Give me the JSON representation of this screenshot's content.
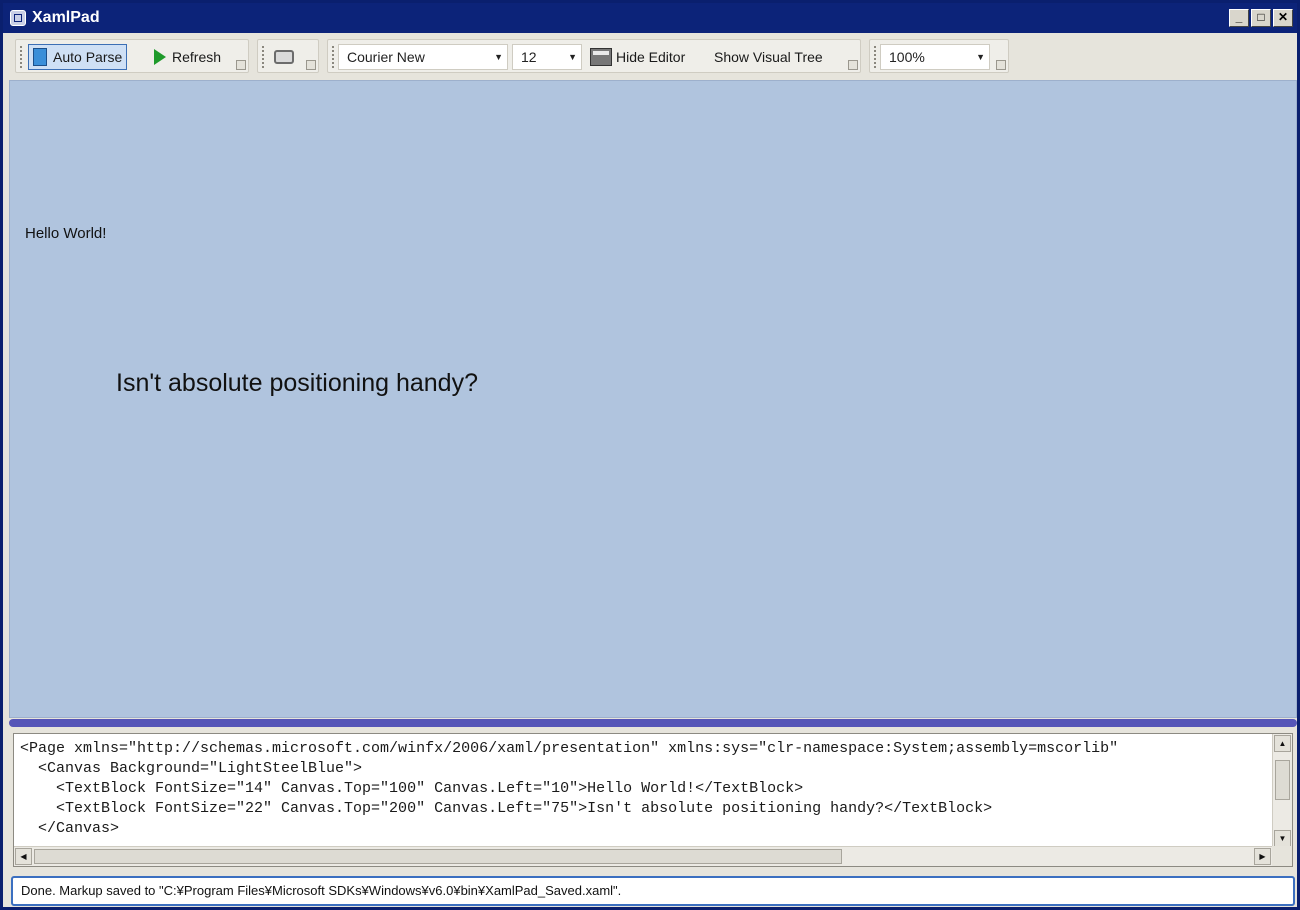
{
  "window": {
    "title": "XamlPad",
    "controls": {
      "minimize": "_",
      "maximize": "□",
      "close": "✕"
    }
  },
  "toolbar": {
    "auto_parse_label": "Auto Parse",
    "refresh_label": "Refresh",
    "font_family": "Courier New",
    "font_size": "12",
    "hide_editor_label": "Hide Editor",
    "show_visual_tree_label": "Show Visual Tree",
    "zoom": "100%",
    "dropdown_arrow": "▼"
  },
  "canvas": {
    "background": "#b0c4de",
    "text1": "Hello World!",
    "text2": "Isn't absolute positioning handy?"
  },
  "editor": {
    "code": "<Page xmlns=\"http://schemas.microsoft.com/winfx/2006/xaml/presentation\" xmlns:sys=\"clr-namespace:System;assembly=mscorlib\"\n  <Canvas Background=\"LightSteelBlue\">\n    <TextBlock FontSize=\"14\" Canvas.Top=\"100\" Canvas.Left=\"10\">Hello World!</TextBlock>\n    <TextBlock FontSize=\"22\" Canvas.Top=\"200\" Canvas.Left=\"75\">Isn't absolute positioning handy?</TextBlock>\n  </Canvas>",
    "scroll_up": "▲",
    "scroll_down": "▼",
    "scroll_left": "◀",
    "scroll_right": "▶"
  },
  "status": {
    "text": "Done. Markup saved to \"C:¥Program Files¥Microsoft SDKs¥Windows¥v6.0¥bin¥XamlPad_Saved.xaml\"."
  }
}
